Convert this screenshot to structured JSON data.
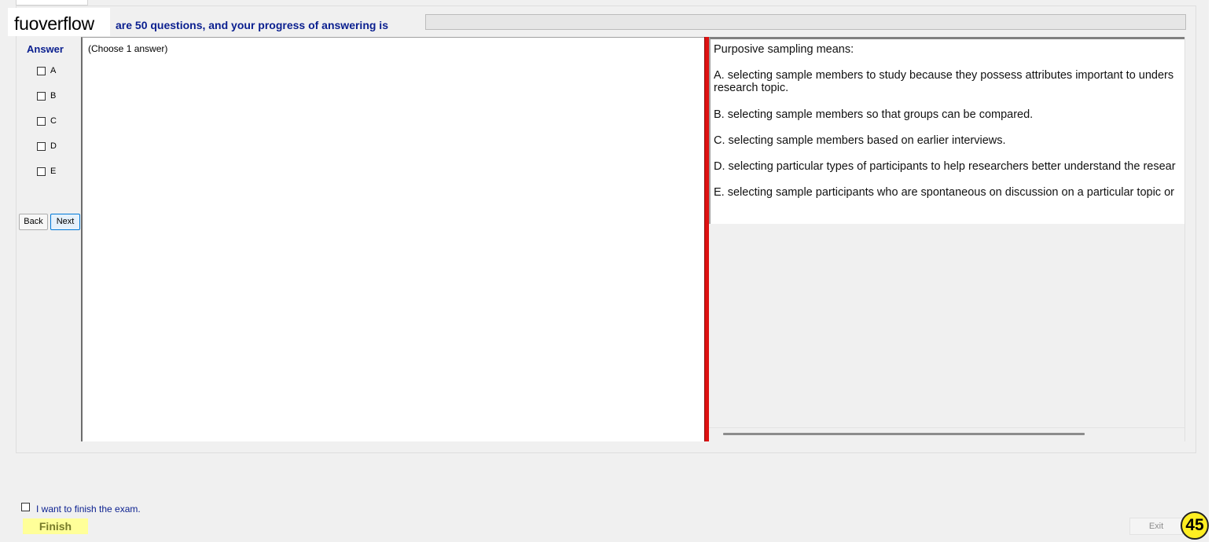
{
  "watermark": "fuoverflow",
  "progress": {
    "text": "are 50 questions, and your progress of answering is",
    "fill_fraction": 0
  },
  "answer_panel": {
    "title": "Answer",
    "options": [
      "A",
      "B",
      "C",
      "D",
      "E"
    ],
    "back_label": "Back",
    "next_label": "Next",
    "hint": "(Choose 1 answer)"
  },
  "question": {
    "lines": [
      "Purposive sampling means:",
      "A.  selecting sample members to study because they possess attributes important to unders",
      "research topic.",
      "B.  selecting sample members so that groups can be compared.",
      "C.  selecting sample members based on earlier interviews.",
      "D.  selecting particular types of participants to help researchers better understand the resear",
      "E.  selecting sample participants who are spontaneous on discussion on a particular topic or"
    ]
  },
  "footer": {
    "finish_check_label": "I want to finish the exam.",
    "finish_label": "Finish",
    "exit_label": "Exit",
    "badge_number": "45"
  },
  "colors": {
    "label_blue": "#0a1f8f",
    "splitter_red": "#dd1111",
    "finish_yellow": "#ffff99",
    "badge_yellow": "#ffee22"
  }
}
